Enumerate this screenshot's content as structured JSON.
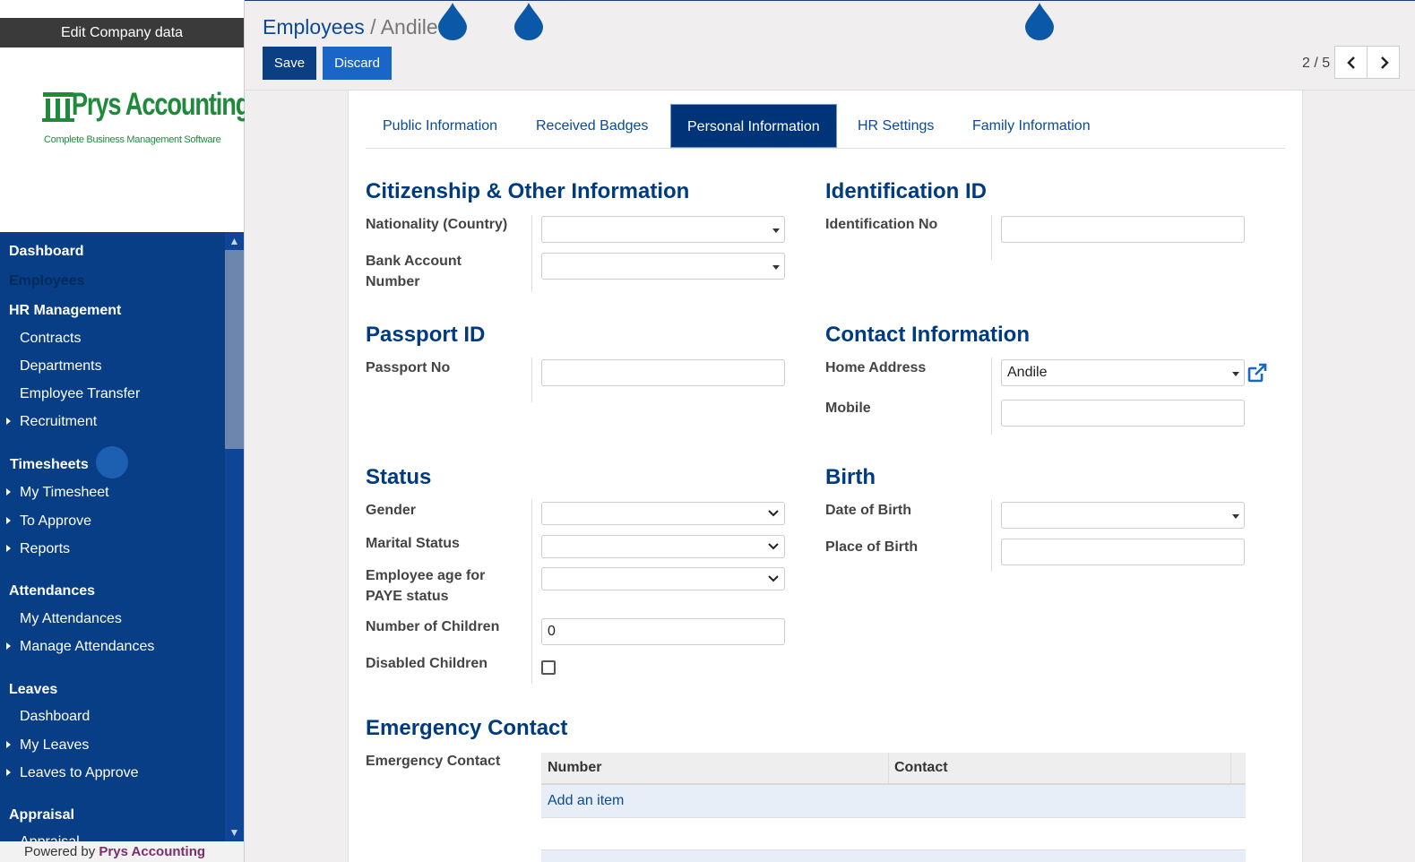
{
  "sidebar": {
    "edit_company": "Edit Company data",
    "logo_name": "Prys Accounting",
    "logo_tagline": "Complete Business Management Software",
    "menu": [
      {
        "label": "Dashboard"
      },
      {
        "label": "Employees"
      },
      {
        "label": "HR Management"
      },
      {
        "label": "Contracts"
      },
      {
        "label": "Departments"
      },
      {
        "label": "Employee Transfer"
      },
      {
        "label": "Recruitment"
      },
      {
        "label": "Timesheets"
      },
      {
        "label": "My Timesheet"
      },
      {
        "label": "To Approve"
      },
      {
        "label": "Reports"
      },
      {
        "label": "Attendances"
      },
      {
        "label": "My Attendances"
      },
      {
        "label": "Manage Attendances"
      },
      {
        "label": "Leaves"
      },
      {
        "label": "Dashboard"
      },
      {
        "label": "My Leaves"
      },
      {
        "label": "Leaves to Approve"
      },
      {
        "label": "Appraisal"
      },
      {
        "label": "Appraisal"
      }
    ],
    "powered_prefix": "Powered by ",
    "powered_brand": "Prys Accounting"
  },
  "header": {
    "breadcrumb_root": "Employees",
    "breadcrumb_sep": "/",
    "breadcrumb_current": "Andile",
    "save_label": "Save",
    "discard_label": "Discard",
    "pager": "2 / 5"
  },
  "tabs": [
    {
      "label": "Public Information"
    },
    {
      "label": "Received Badges"
    },
    {
      "label": "Personal Information",
      "active": true
    },
    {
      "label": "HR Settings"
    },
    {
      "label": "Family Information"
    }
  ],
  "sections": {
    "citizenship": {
      "title": "Citizenship & Other Information",
      "nationality_label": "Nationality (Country)",
      "nationality_value": "",
      "bank_label": "Bank Account Number",
      "bank_value": ""
    },
    "identification": {
      "title": "Identification ID",
      "id_no_label": "Identification No",
      "id_no_value": ""
    },
    "passport": {
      "title": "Passport ID",
      "passport_no_label": "Passport No",
      "passport_no_value": ""
    },
    "contact": {
      "title": "Contact Information",
      "home_address_label": "Home Address",
      "home_address_value": "Andile",
      "mobile_label": "Mobile",
      "mobile_value": ""
    },
    "status": {
      "title": "Status",
      "gender_label": "Gender",
      "gender_value": "",
      "marital_label": "Marital Status",
      "marital_value": "",
      "paye_label": "Employee age for PAYE status",
      "paye_value": "",
      "children_label": "Number of Children",
      "children_value": "0",
      "disabled_children_label": "Disabled Children",
      "disabled_children_checked": false
    },
    "birth": {
      "title": "Birth",
      "dob_label": "Date of Birth",
      "dob_value": "",
      "pob_label": "Place of Birth",
      "pob_value": ""
    },
    "emergency": {
      "title": "Emergency Contact",
      "field_label": "Emergency Contact",
      "columns": [
        "Number",
        "Contact"
      ],
      "add_item": "Add an item"
    }
  },
  "colors": {
    "sidebar_bg": "#073e85",
    "primary": "#003479",
    "link": "#0b4a96",
    "section_title": "#003a80"
  }
}
